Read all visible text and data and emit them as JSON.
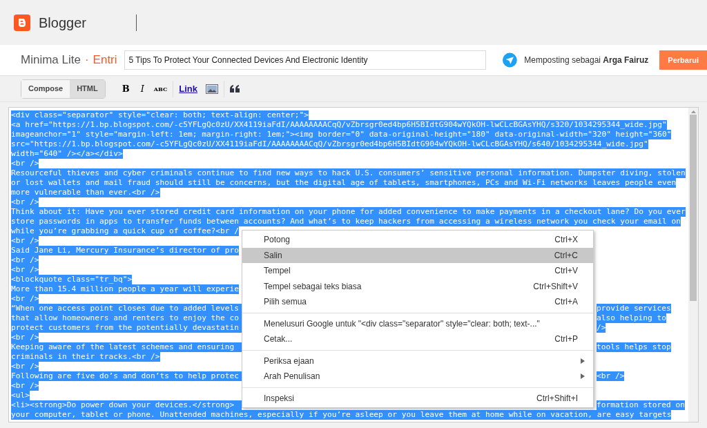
{
  "app": {
    "name": "Blogger"
  },
  "post": {
    "blog": "Minima Lite",
    "separator": "·",
    "section": "Entri",
    "title": "5 Tips To Protect Your Connected Devices And Electronic Identity",
    "posting_as": "Memposting sebagai **Arga Fairuz**",
    "update_button": "Perbarui"
  },
  "modes": [
    {
      "label": "Compose",
      "selected": false
    },
    {
      "label": "HTML",
      "selected": true
    }
  ],
  "toolbar": [
    {
      "kind": "bold",
      "label": "B"
    },
    {
      "kind": "italic",
      "label": "I"
    },
    {
      "kind": "spell",
      "label": "ABC"
    },
    {
      "kind": "link",
      "label": "Link"
    },
    {
      "kind": "image"
    },
    {
      "kind": "quote"
    }
  ],
  "code": {
    "selected": true,
    "lines": [
      {
        "text": "<div class=\"separator\" style=\"clear: both; text-align: center;\">"
      },
      {
        "text": "<a href=\"https://1.bp.blogspot.com/-c5YFLgQc0zU/XX4119iaFdI/AAAAAAAACqQ/vZbrsgr0ed4bp6H5BIdtG904wYQkOH-lwCLcBGAsYHQ/s320/1034295344_wide.jpg\""
      },
      {
        "text": "imageanchor=\"1\" style=\"margin-left: 1em; margin-right: 1em;\"><img border=\"0\" data-original-height=\"180\" data-original-width=\"320\" height=\"360\""
      },
      {
        "text": "src=\"https://1.bp.blogspot.com/-c5YFLgQc0zU/XX4119iaFdI/AAAAAAAACqQ/vZbrsgr0ed4bp6H5BIdtG904wYQkOH-lwCLcBGAsYHQ/s640/1034295344_wide.jpg\""
      },
      {
        "text": "width=\"640\" /></a></div>"
      },
      {
        "text": "<br />"
      },
      {
        "text": "Resourceful thieves and cyber criminals continue to find new ways to hack U.S. consumers’ sensitive personal information. Dumpster diving, stolen"
      },
      {
        "text": "or lost wallets and mail fraud should still be concerns, but the digital age of tablets, smartphones, PCs and Wi-Fi networks leaves people even"
      },
      {
        "text": "more vulnerable than ever.<br />"
      },
      {
        "text": "<br />"
      },
      {
        "text": "Think about it: Have you ever stored credit card information on your phone for added convenience to make payments in a checkout lane? Do you ever"
      },
      {
        "text": "store passwords in apps to transfer funds between accounts? And what’s to keep hackers from accessing a wireless network you check your email on"
      },
      {
        "text": "while you’re grabbing a quick cup of coffee?<br /"
      },
      {
        "text": "<br />"
      },
      {
        "text": "Said Jane Li, Mercury Insurance’s director of pro"
      },
      {
        "text": "<br />"
      },
      {
        "text": "<br />"
      },
      {
        "text": "<blockquote class=\"tr_bq\">"
      },
      {
        "text": "More than 15.4 million people a year will experie"
      },
      {
        "text": "<br />"
      },
      {
        "text": "“When one access point closes due to added levels",
        "right": "provide services"
      },
      {
        "text": "that allow homeowners and renters to enjoy the co",
        "right": "also helping to"
      },
      {
        "text": "protect customers from the potentially devastatin",
        "right": "/>"
      },
      {
        "text": "<br />"
      },
      {
        "text": "Keeping aware of the latest schemes and ensuring",
        "right": "tools helps stop"
      },
      {
        "text": "criminals in their tracks.<br />"
      },
      {
        "text": "<br />"
      },
      {
        "text": "Following are five do’s and don’ts to help protec",
        "right": "<br />"
      },
      {
        "text": "<br />"
      },
      {
        "text": "<ul>"
      },
      {
        "text": "<li><strong>Do power down your devices.</strong>",
        "right": "formation stored on"
      },
      {
        "text": "your computer, tablet or phone. Unattended machines, especially if you’re asleep or you leave them at home while on vacation, are easy targets"
      }
    ]
  },
  "context_menu": {
    "groups": [
      [
        {
          "label": "Potong",
          "shortcut": "Ctrl+X",
          "selected": false,
          "submenu": false
        },
        {
          "label": "Salin",
          "shortcut": "Ctrl+C",
          "selected": true,
          "submenu": false
        },
        {
          "label": "Tempel",
          "shortcut": "Ctrl+V",
          "selected": false,
          "submenu": false
        },
        {
          "label": "Tempel sebagai teks biasa",
          "shortcut": "Ctrl+Shift+V",
          "selected": false,
          "submenu": false
        },
        {
          "label": "Pilih semua",
          "shortcut": "Ctrl+A",
          "selected": false,
          "submenu": false
        }
      ],
      [
        {
          "label": "Menelusuri Google untuk \"<div class=\"separator\" style=\"clear: both; text-...\"",
          "selected": false,
          "submenu": false
        },
        {
          "label": "Cetak...",
          "shortcut": "Ctrl+P",
          "selected": false,
          "submenu": false
        }
      ],
      [
        {
          "label": "Periksa ejaan",
          "selected": false,
          "submenu": true
        },
        {
          "label": "Arah Penulisan",
          "selected": false,
          "submenu": true
        }
      ],
      [
        {
          "label": "Inspeksi",
          "shortcut": "Ctrl+Shift+I",
          "selected": false,
          "submenu": false
        }
      ]
    ]
  }
}
